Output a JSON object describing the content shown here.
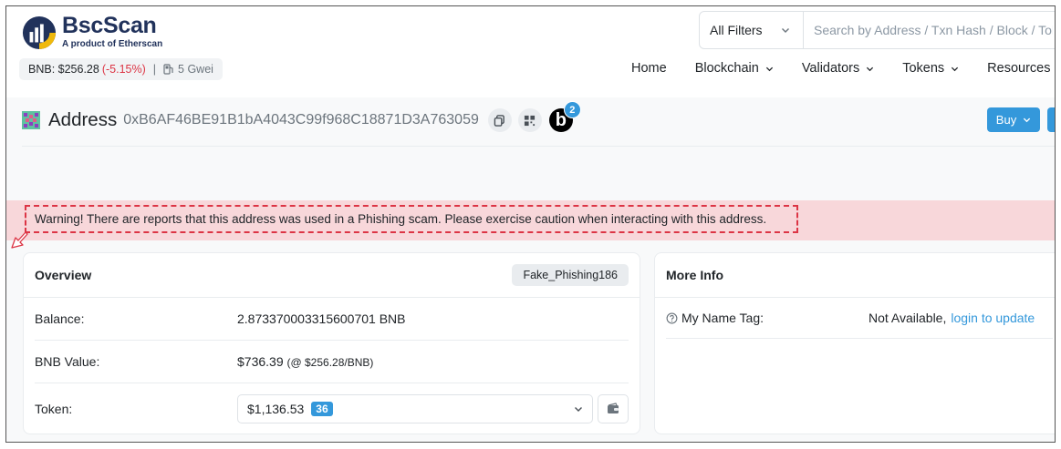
{
  "brand": {
    "name": "BscScan",
    "tagline": "A product of Etherscan"
  },
  "ticker": {
    "price": "BNB: $256.28",
    "change": "(-5.15%)",
    "separator": "|",
    "gas": "5 Gwei"
  },
  "search": {
    "filter_label": "All Filters",
    "placeholder": "Search by Address / Txn Hash / Block / Token"
  },
  "nav": {
    "home": "Home",
    "blockchain": "Blockchain",
    "validators": "Validators",
    "tokens": "Tokens",
    "resources": "Resources"
  },
  "address": {
    "label": "Address",
    "hash": "0xB6AF46BE91B1bA4043C99f968C18871D3A763059",
    "badge_letter": "b",
    "badge_count": "2",
    "buy_label": "Buy"
  },
  "warning": {
    "text": "Warning! There are reports that this address was used in a Phishing scam. Please exercise caution when interacting with this address."
  },
  "overview": {
    "title": "Overview",
    "tag": "Fake_Phishing186",
    "balance_label": "Balance:",
    "balance_value": "2.873370003315600701 BNB",
    "value_label": "BNB Value:",
    "value_amount": "$736.39",
    "value_rate": "(@ $256.28/BNB)",
    "token_label": "Token:",
    "token_value": "$1,136.53",
    "token_count": "36"
  },
  "more_info": {
    "title": "More Info",
    "name_tag_label": "My Name Tag:",
    "name_tag_value": "Not Available,",
    "name_tag_link": "login to update"
  },
  "colors": {
    "accent": "#3498db",
    "danger": "#dc3545",
    "warning_bg": "#f8d7da",
    "brand_navy": "#21325b"
  }
}
